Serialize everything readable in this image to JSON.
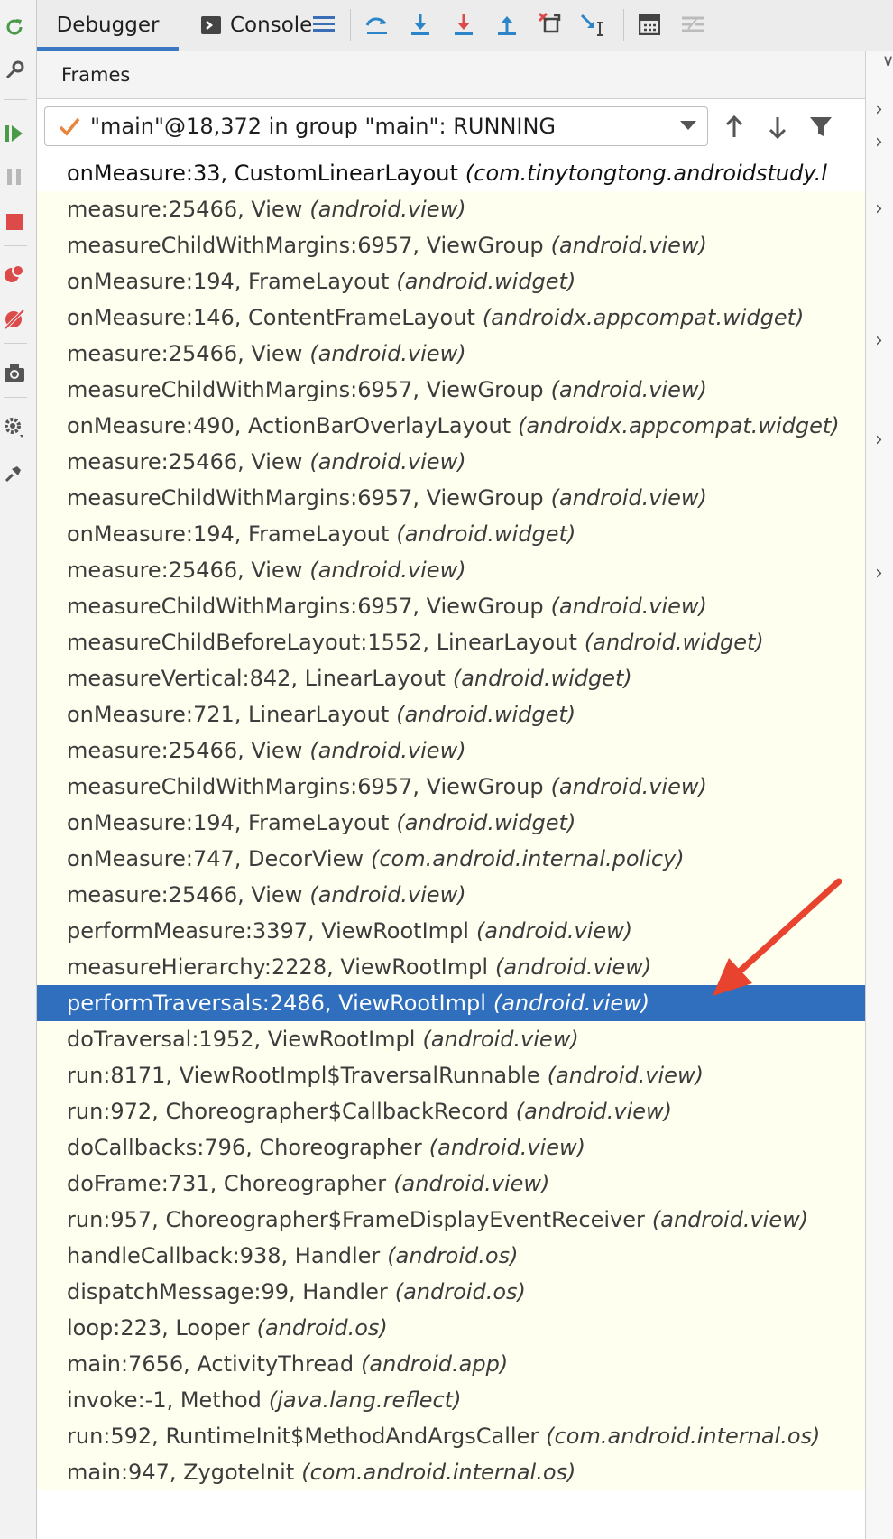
{
  "tabs": {
    "debugger": "Debugger",
    "console": "Console"
  },
  "toolbar_icons": [
    "threads-menu-icon",
    "show-execution-point-icon",
    "step-over-icon",
    "step-into-icon",
    "force-step-into-icon",
    "step-out-icon",
    "drop-frame-icon",
    "run-to-cursor-icon",
    "evaluate-expression-icon",
    "trace-icon"
  ],
  "left_toolbar_icons": [
    "rerun-icon",
    "settings-wrench-icon",
    "resume-icon",
    "pause-icon",
    "stop-icon",
    "view-breakpoints-icon",
    "mute-breakpoints-icon",
    "camera-icon",
    "gear-icon",
    "pin-icon"
  ],
  "frames_panel": {
    "title": "Frames",
    "thread_selector": "\"main\"@18,372 in group \"main\": RUNNING"
  },
  "frames": [
    {
      "method": "onMeasure:33, CustomLinearLayout",
      "package": "(com.tinytongtong.androidstudy.l"
    },
    {
      "method": "measure:25466, View",
      "package": "(android.view)"
    },
    {
      "method": "measureChildWithMargins:6957, ViewGroup",
      "package": "(android.view)"
    },
    {
      "method": "onMeasure:194, FrameLayout",
      "package": "(android.widget)"
    },
    {
      "method": "onMeasure:146, ContentFrameLayout",
      "package": "(androidx.appcompat.widget)"
    },
    {
      "method": "measure:25466, View",
      "package": "(android.view)"
    },
    {
      "method": "measureChildWithMargins:6957, ViewGroup",
      "package": "(android.view)"
    },
    {
      "method": "onMeasure:490, ActionBarOverlayLayout",
      "package": "(androidx.appcompat.widget)"
    },
    {
      "method": "measure:25466, View",
      "package": "(android.view)"
    },
    {
      "method": "measureChildWithMargins:6957, ViewGroup",
      "package": "(android.view)"
    },
    {
      "method": "onMeasure:194, FrameLayout",
      "package": "(android.widget)"
    },
    {
      "method": "measure:25466, View",
      "package": "(android.view)"
    },
    {
      "method": "measureChildWithMargins:6957, ViewGroup",
      "package": "(android.view)"
    },
    {
      "method": "measureChildBeforeLayout:1552, LinearLayout",
      "package": "(android.widget)"
    },
    {
      "method": "measureVertical:842, LinearLayout",
      "package": "(android.widget)"
    },
    {
      "method": "onMeasure:721, LinearLayout",
      "package": "(android.widget)"
    },
    {
      "method": "measure:25466, View",
      "package": "(android.view)"
    },
    {
      "method": "measureChildWithMargins:6957, ViewGroup",
      "package": "(android.view)"
    },
    {
      "method": "onMeasure:194, FrameLayout",
      "package": "(android.widget)"
    },
    {
      "method": "onMeasure:747, DecorView",
      "package": "(com.android.internal.policy)"
    },
    {
      "method": "measure:25466, View",
      "package": "(android.view)"
    },
    {
      "method": "performMeasure:3397, ViewRootImpl",
      "package": "(android.view)"
    },
    {
      "method": "measureHierarchy:2228, ViewRootImpl",
      "package": "(android.view)"
    },
    {
      "method": "performTraversals:2486, ViewRootImpl",
      "package": "(android.view)"
    },
    {
      "method": "doTraversal:1952, ViewRootImpl",
      "package": "(android.view)"
    },
    {
      "method": "run:8171, ViewRootImpl$TraversalRunnable",
      "package": "(android.view)"
    },
    {
      "method": "run:972, Choreographer$CallbackRecord",
      "package": "(android.view)"
    },
    {
      "method": "doCallbacks:796, Choreographer",
      "package": "(android.view)"
    },
    {
      "method": "doFrame:731, Choreographer",
      "package": "(android.view)"
    },
    {
      "method": "run:957, Choreographer$FrameDisplayEventReceiver",
      "package": "(android.view)"
    },
    {
      "method": "handleCallback:938, Handler",
      "package": "(android.os)"
    },
    {
      "method": "dispatchMessage:99, Handler",
      "package": "(android.os)"
    },
    {
      "method": "loop:223, Looper",
      "package": "(android.os)"
    },
    {
      "method": "main:7656, ActivityThread",
      "package": "(android.app)"
    },
    {
      "method": "invoke:-1, Method",
      "package": "(java.lang.reflect)"
    },
    {
      "method": "run:592, RuntimeInit$MethodAndArgsCaller",
      "package": "(com.android.internal.os)"
    },
    {
      "method": "main:947, ZygoteInit",
      "package": "(com.android.internal.os)"
    }
  ],
  "selected_frame_index": 23,
  "colors": {
    "selected_row": "#2f6fbe",
    "frames_background": "#fffff0",
    "annotation_arrow": "#e8432f",
    "tab_underline": "#3a78c2"
  }
}
